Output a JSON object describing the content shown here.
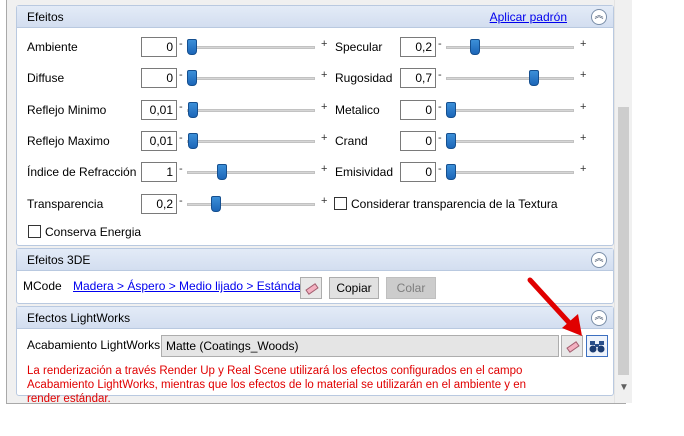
{
  "efeitos": {
    "title": "Efeitos",
    "apply_default": "Aplicar padrón",
    "collapse_glyph": "︽",
    "left_params": [
      {
        "label": "Ambiente",
        "value": "0",
        "minus": "-",
        "plus": "+",
        "level": 0.0
      },
      {
        "label": "Diffuse",
        "value": "0",
        "minus": "-",
        "plus": "+",
        "level": 0.0
      },
      {
        "label": "Reflejo Minimo",
        "value": "0,01",
        "minus": "-",
        "plus": "+",
        "level": 0.01
      },
      {
        "label": "Reflejo Maximo",
        "value": "0,01",
        "minus": "-",
        "plus": "+",
        "level": 0.01
      },
      {
        "label": "Índice de Refracción",
        "value": "1",
        "minus": "-",
        "plus": "+",
        "level": 0.25
      },
      {
        "label": "Transparencia",
        "value": "0,2",
        "minus": "-",
        "plus": "+",
        "level": 0.2
      }
    ],
    "right_params": [
      {
        "label": "Specular",
        "value": "0,2",
        "minus": "-",
        "plus": "+",
        "level": 0.2
      },
      {
        "label": "Rugosidad",
        "value": "0,7",
        "minus": "-",
        "plus": "+",
        "level": 0.7
      },
      {
        "label": "Metalico",
        "value": "0",
        "minus": "-",
        "plus": "+",
        "level": 0.0
      },
      {
        "label": "Crand",
        "value": "0",
        "minus": "-",
        "plus": "+",
        "level": 0.0
      },
      {
        "label": "Emisividad",
        "value": "0",
        "minus": "-",
        "plus": "+",
        "level": 0.0
      }
    ],
    "consider_texture_transparency": {
      "label": "Considerar transparencia de la Textura",
      "checked": false
    },
    "conserve_energy": {
      "label": "Conserva Energia",
      "checked": false
    }
  },
  "efeitos3de": {
    "title": "Efeitos 3DE",
    "collapse_glyph": "︽",
    "mcode_label": "MCode",
    "mcode_link": "Madera > Áspero > Medio lijado > Estándar",
    "copy_label": "Copiar",
    "paste_label": "Colar"
  },
  "lightworks": {
    "title": "Efectos LightWorks",
    "collapse_glyph": "︽",
    "finish_label": "Acabamiento LightWorks",
    "finish_value": "Matte (Coatings_Woods)",
    "note": "La renderización a través Render Up y Real Scene utilizará los efectos configurados en el campo Acabamiento LightWorks, mientras que los efectos de lo material se utilizarán en el ambiente y en render estándar."
  },
  "scrollbar": {
    "down_arrow": "▼"
  },
  "icons": {
    "eraser": "eraser-icon",
    "binoculars": "binoculars-icon",
    "collapse": "collapse-up-icon",
    "arrow": "red-arrow-annotation"
  },
  "colors": {
    "accent_thumb": "#1c66b8",
    "panel_header": "#d3def0",
    "note_text": "#e00000",
    "annotation": "#e00000",
    "link": "#0000ee"
  }
}
